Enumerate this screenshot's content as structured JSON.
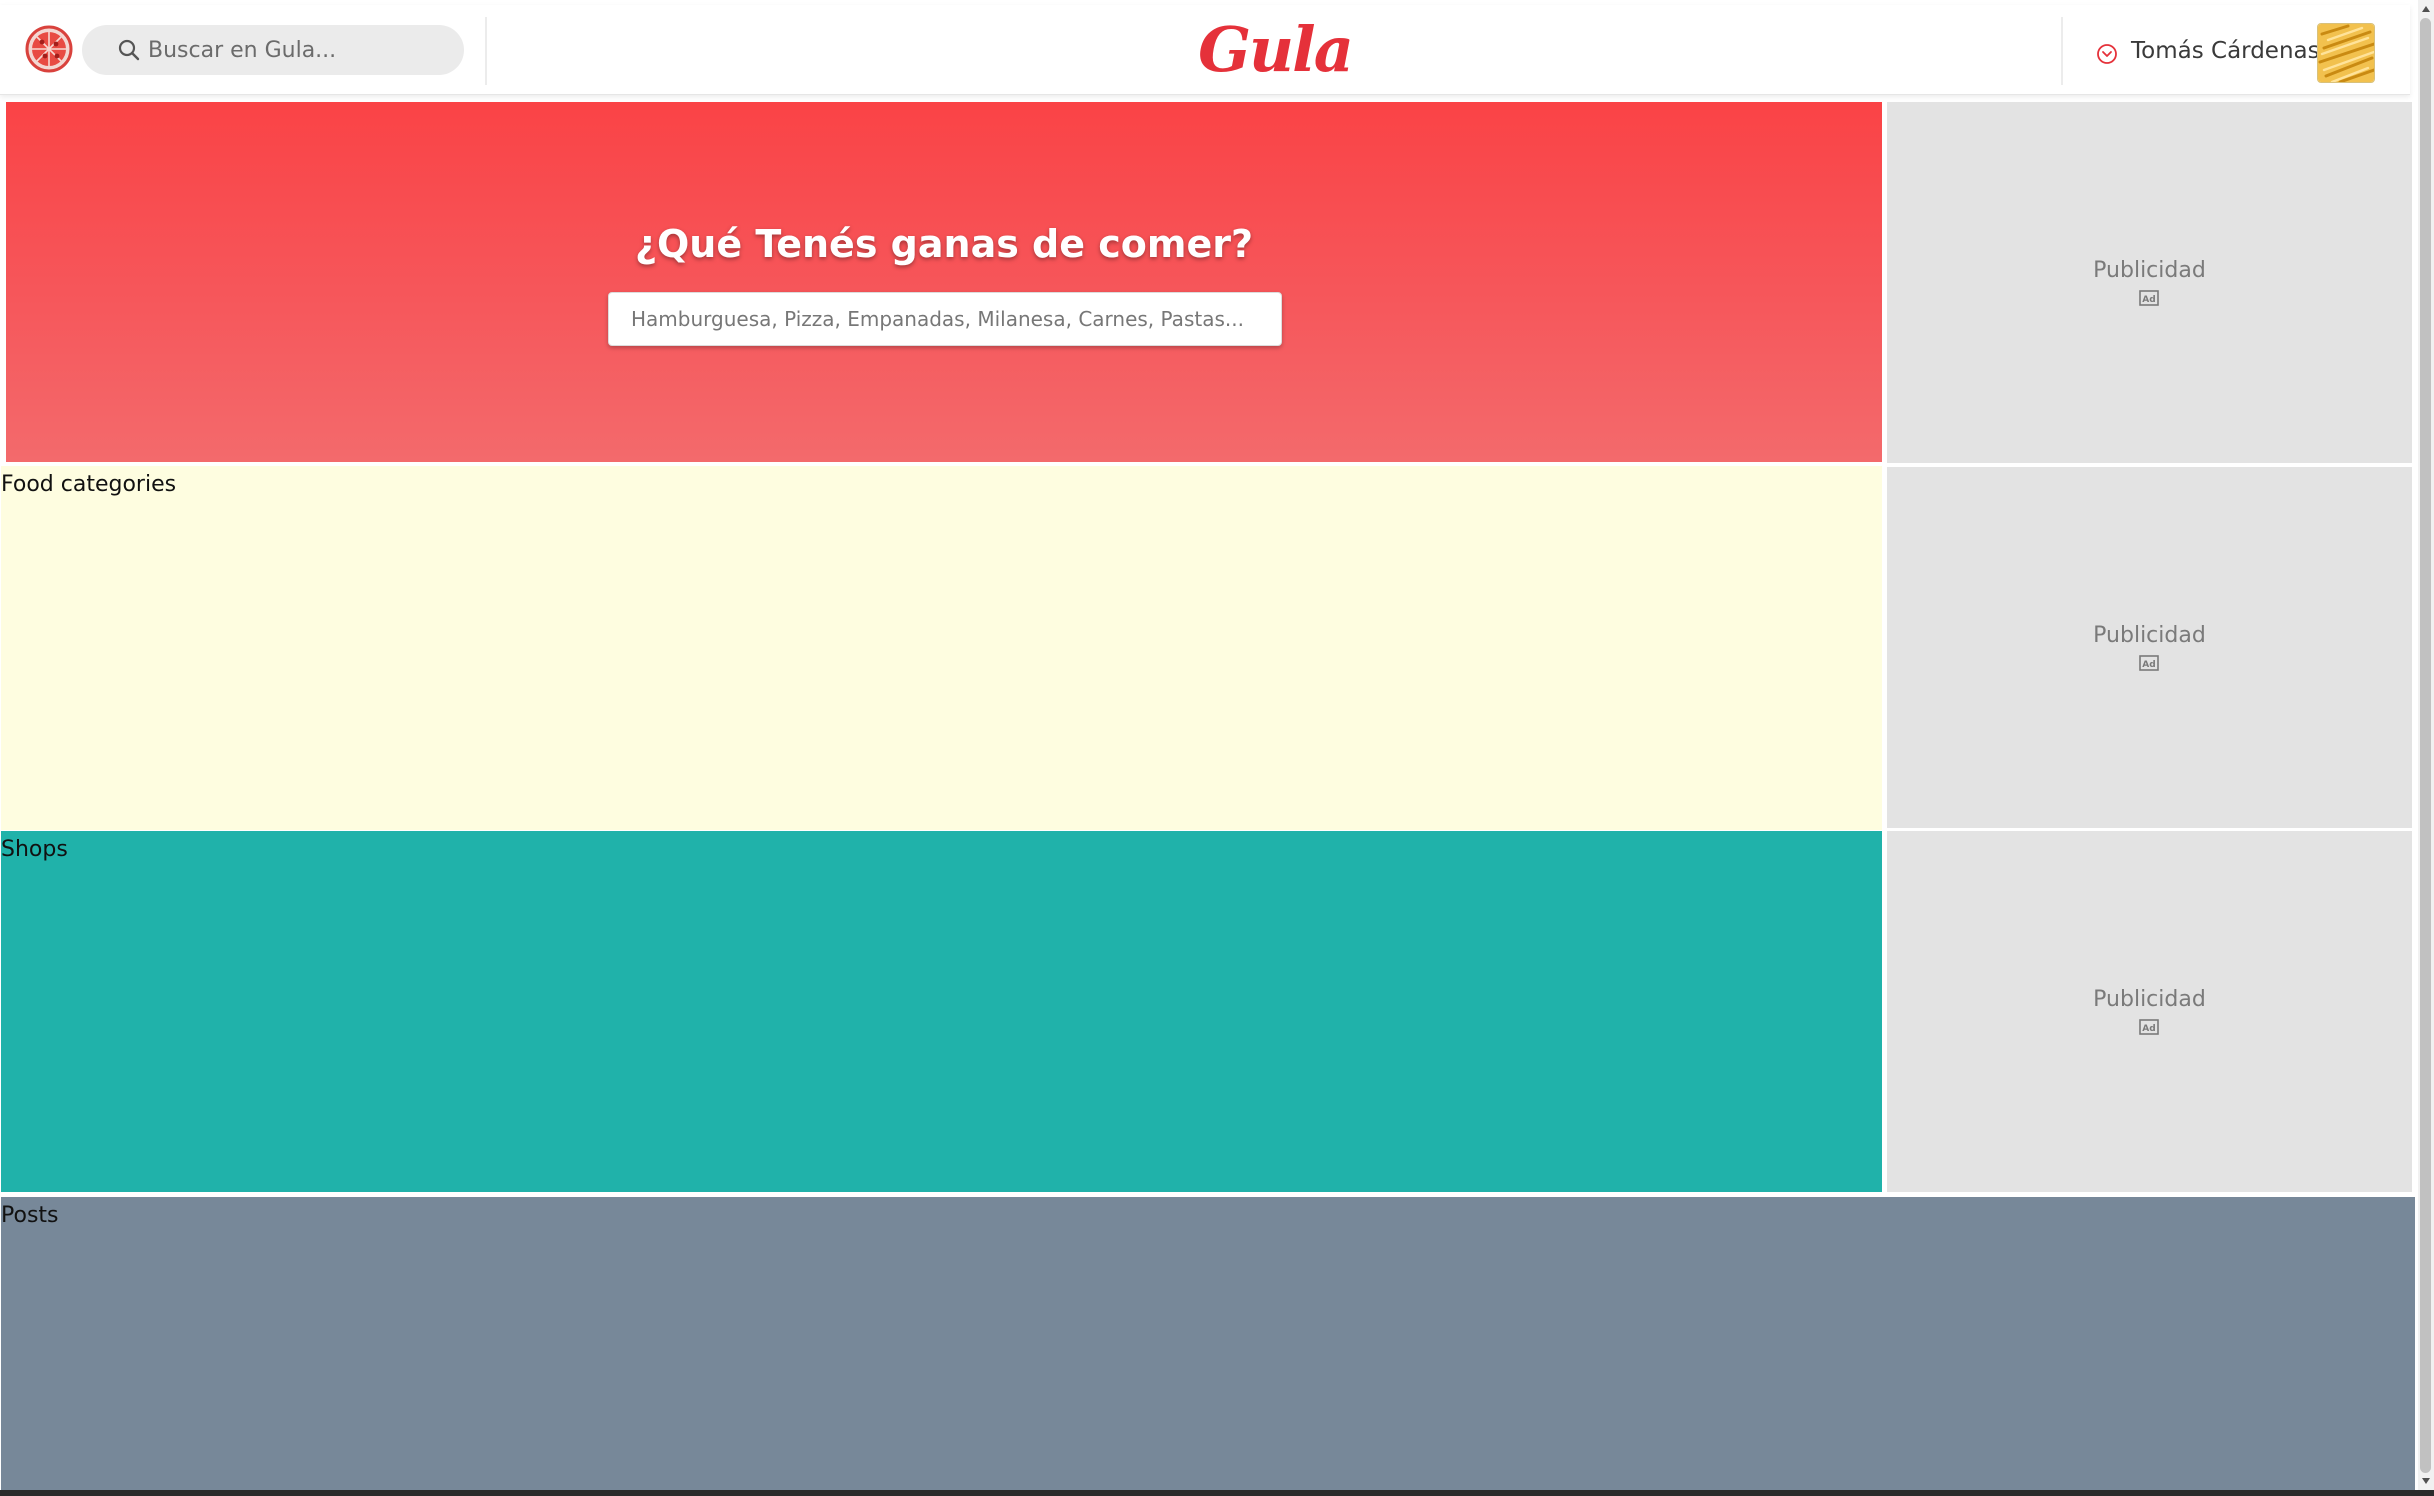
{
  "header": {
    "logo_icon": "pizza-icon",
    "search": {
      "placeholder": "Buscar en Gula...",
      "icon": "search-icon"
    },
    "brand": "Gula",
    "user": {
      "name": "Tomás Cárdenas",
      "menu_icon": "chevron-down-circle-icon",
      "avatar_icon": "fries-avatar"
    }
  },
  "hero": {
    "title": "¿Qué Tenés ganas de comer?",
    "search_placeholder": "Hamburguesa, Pizza, Empanadas, Milanesa, Carnes, Pastas..."
  },
  "sections": {
    "categories": "Food categories",
    "shops": "Shops",
    "posts": "Posts"
  },
  "ads": [
    {
      "label": "Publicidad",
      "icon": "ad-icon"
    },
    {
      "label": "Publicidad",
      "icon": "ad-icon"
    },
    {
      "label": "Publicidad",
      "icon": "ad-icon"
    }
  ],
  "colors": {
    "brand": "#e5313a",
    "hero_top": "#fa4346",
    "hero_bottom": "#f36a6c",
    "categories_bg": "#fefde0",
    "shops_bg": "#20b2aa",
    "posts_bg": "#778899",
    "ad_bg": "#e3e3e3"
  }
}
